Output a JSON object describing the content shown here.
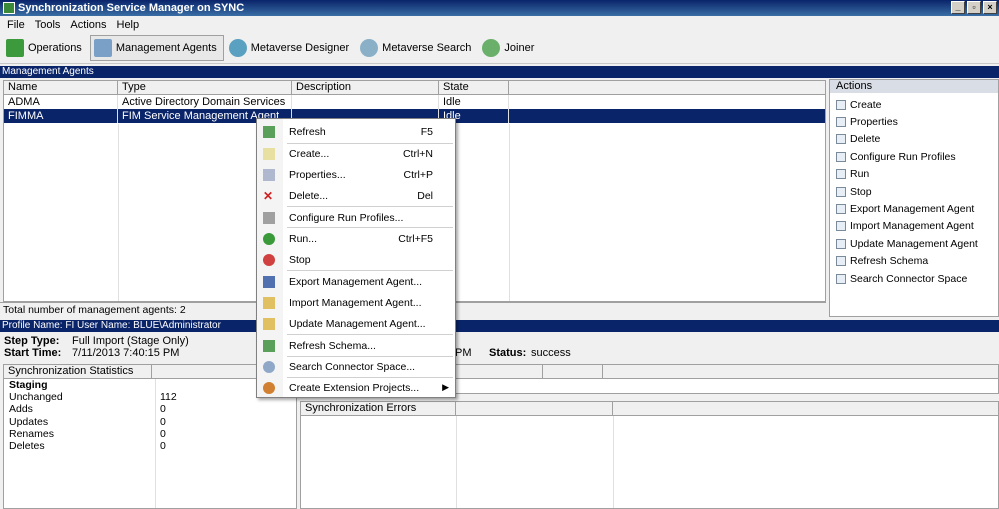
{
  "window": {
    "title": "Synchronization Service Manager on SYNC"
  },
  "menu": [
    "File",
    "Tools",
    "Actions",
    "Help"
  ],
  "toolbar": [
    {
      "label": "Operations",
      "icon": "operations-icon",
      "active": false
    },
    {
      "label": "Management Agents",
      "icon": "management-agents-icon",
      "active": true
    },
    {
      "label": "Metaverse Designer",
      "icon": "metaverse-designer-icon",
      "active": false
    },
    {
      "label": "Metaverse Search",
      "icon": "metaverse-search-icon",
      "active": false
    },
    {
      "label": "Joiner",
      "icon": "joiner-icon",
      "active": false
    }
  ],
  "ma_panel": {
    "title": "Management Agents",
    "columns": [
      "Name",
      "Type",
      "Description",
      "State"
    ],
    "rows": [
      {
        "name": "ADMA",
        "type": "Active Directory Domain Services",
        "description": "",
        "state": "Idle",
        "selected": false
      },
      {
        "name": "FIMMA",
        "type": "FIM Service Management Agent",
        "description": "",
        "state": "Idle",
        "selected": true
      }
    ],
    "footer": "Total number of management agents: 2"
  },
  "actions": {
    "title": "Actions",
    "items": [
      "Create",
      "Properties",
      "Delete",
      "Configure Run Profiles",
      "Run",
      "Stop",
      "Export Management Agent",
      "Import Management Agent",
      "Update Management Agent",
      "Refresh Schema",
      "Search Connector Space"
    ]
  },
  "context_menu": {
    "items": [
      {
        "label": "Refresh",
        "shortcut": "F5",
        "icon": "refresh-icon"
      },
      {
        "label": "Create...",
        "shortcut": "Ctrl+N",
        "icon": "create-icon"
      },
      {
        "label": "Properties...",
        "shortcut": "Ctrl+P",
        "icon": "properties-icon"
      },
      {
        "label": "Delete...",
        "shortcut": "Del",
        "icon": "delete-icon"
      },
      {
        "label": "Configure Run Profiles...",
        "shortcut": "",
        "icon": "configure-icon"
      },
      {
        "label": "Run...",
        "shortcut": "Ctrl+F5",
        "icon": "run-icon"
      },
      {
        "label": "Stop",
        "shortcut": "",
        "icon": "stop-icon"
      },
      {
        "label": "Export Management Agent...",
        "shortcut": "",
        "icon": "export-icon"
      },
      {
        "label": "Import Management Agent...",
        "shortcut": "",
        "icon": "import-icon"
      },
      {
        "label": "Update Management Agent...",
        "shortcut": "",
        "icon": "update-icon"
      },
      {
        "label": "Refresh Schema...",
        "shortcut": "",
        "icon": "refresh-schema-icon"
      },
      {
        "label": "Search Connector Space...",
        "shortcut": "",
        "icon": "search-icon"
      },
      {
        "label": "Create Extension Projects...",
        "shortcut": "",
        "icon": "extension-icon",
        "submenu": true
      }
    ]
  },
  "profile": {
    "band": "Profile Name: FI  User Name: BLUE\\Administrator",
    "step_type_label": "Step Type:",
    "step_type": "Full Import (Stage Only)",
    "start_time_label": "Start Time:",
    "start_time": "7/11/2013 7:40:15 PM",
    "end_time_partial": "PM",
    "status_label": "Status:",
    "status": "success"
  },
  "stats": {
    "header": "Synchronization Statistics",
    "section": "Staging",
    "rows": [
      {
        "k": "Unchanged",
        "v": "112"
      },
      {
        "k": "Adds",
        "v": "0"
      },
      {
        "k": "Updates",
        "v": "0"
      },
      {
        "k": "Renames",
        "v": "0"
      },
      {
        "k": "Deletes",
        "v": "0"
      }
    ]
  },
  "errors": {
    "header": "Synchronization Errors"
  },
  "colors": {
    "selection": "#0a246a",
    "titlebar": "#0a246a"
  }
}
